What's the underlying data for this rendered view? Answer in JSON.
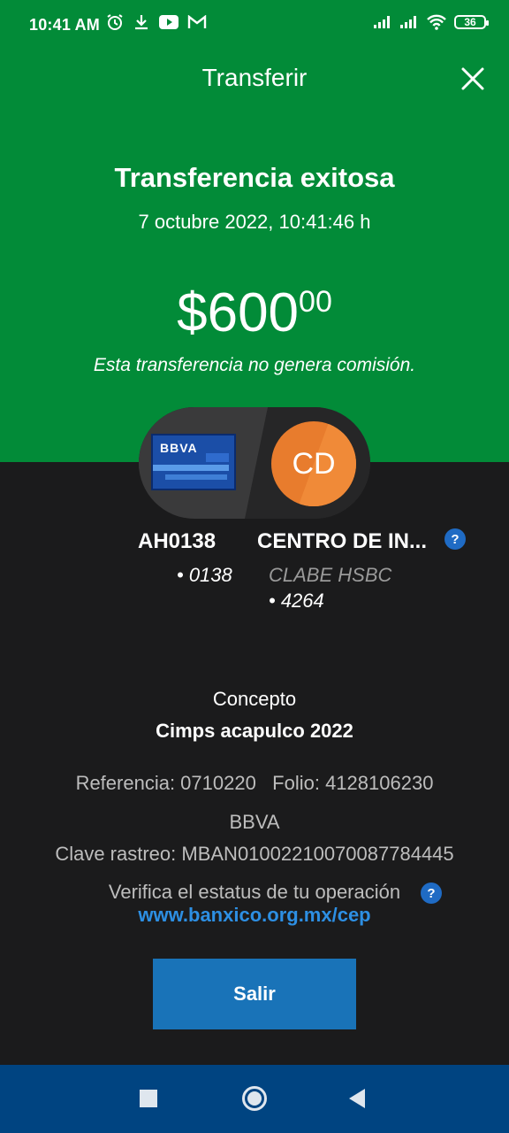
{
  "status_bar": {
    "time": "10:41 AM",
    "battery": "36",
    "icons": [
      "alarm-icon",
      "download-icon",
      "youtube-icon",
      "gmail-icon",
      "signal-icon",
      "signal-icon",
      "wifi-icon",
      "battery-icon"
    ]
  },
  "header": {
    "title": "Transferir",
    "close_icon": "close-icon"
  },
  "success": {
    "title": "Transferencia exitosa",
    "datetime": "7 octubre 2022, 10:41:46 h",
    "amount_main": "$600",
    "amount_cents": "00",
    "fee_note": "Esta transferencia no genera comisión."
  },
  "origin": {
    "card_logo": "BBVA",
    "name": "AH0138",
    "number": "• 0138"
  },
  "destination": {
    "initials": "CD",
    "name": "CENTRO DE IN...",
    "bank": "CLABE HSBC",
    "number": "• 4264"
  },
  "details": {
    "concept_label": "Concepto",
    "concept_value": "Cimps acapulco 2022",
    "reference_folio": "Referencia: 0710220   Folio: 4128106230",
    "bank": "BBVA",
    "tracking": "Clave rastreo: MBAN01002210070087784445",
    "verify_text": "Verifica el estatus de tu operación",
    "verify_link": "www.banxico.org.mx/cep"
  },
  "actions": {
    "exit_label": "Salir"
  },
  "colors": {
    "header_green": "#028b38",
    "background": "#1b1b1c",
    "primary_blue": "#1973b8",
    "link_blue": "#2d8fe3",
    "nav_blue": "#004481",
    "avatar_orange": "#e87c2d"
  }
}
